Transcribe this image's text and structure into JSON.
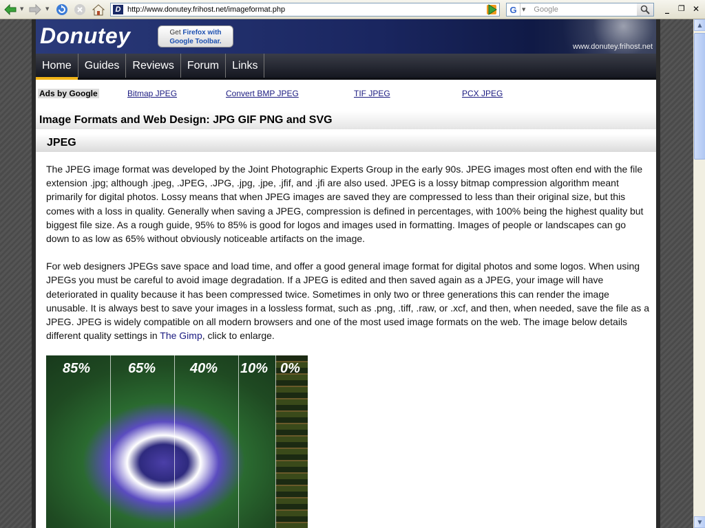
{
  "browser": {
    "url": "http://www.donutey.frihost.net/imageformat.php",
    "search_placeholder": "Google",
    "search_engine_letter": "G"
  },
  "site": {
    "logo": "Donutey",
    "badge_line1_prefix": "Get ",
    "badge_line1_bold": "Firefox with",
    "badge_line2": "Google Toolbar.",
    "url_text": "www.donutey.frihost.net",
    "favicon_letter": "D"
  },
  "nav": [
    "Home",
    "Guides",
    "Reviews",
    "Forum",
    "Links"
  ],
  "ads": {
    "label": "Ads by Google",
    "links": [
      "Bitmap JPEG",
      "Convert BMP JPEG",
      "TIF JPEG",
      "PCX JPEG"
    ]
  },
  "page_title": "Image Formats and Web Design: JPG GIF PNG and SVG",
  "section": {
    "heading": "JPEG",
    "paragraph1": "The JPEG image format was developed by the Joint Photographic Experts Group in the early 90s. JPEG images most often end with the file extension .jpg; although .jpeg, .JPEG, .JPG, .jpg, .jpe, .jfif, and .jfi are also used. JPEG is a lossy bitmap compression algorithm meant primarily for digital photos. Lossy means that when JPEG images are saved they are compressed to less than their original size, but this comes with a loss in quality. Generally when saving a JPEG, compression is defined in percentages, with 100% being the highest quality but biggest file size. As a rough guide, 95% to 85% is good for logos and images used in formatting. Images of people or landscapes can go down to as low as 65% without obviously noticeable artifacts on the image.",
    "paragraph2_before": "For web designers JPEGs save space and load time, and offer a good general image format for digital photos and some logos. When using JPEGs you must be careful to avoid image degradation. If a JPEG is edited and then saved again as a JPEG, your image will have deteriorated in quality because it has been compressed twice. Sometimes in only two or three generations this can render the image unusable. It is always best to save your images in a lossless format, such as .png, .tiff, .raw, or .xcf, and then, when needed, save the file as a JPEG. JPEG is widely compatible on all modern browsers and one of the most used image formats on the web. The image below details different quality settings in ",
    "paragraph2_link": "The Gimp",
    "paragraph2_after": ", click to enlarge."
  },
  "image_labels": [
    "85%",
    "65%",
    "40%",
    "10%",
    "0%"
  ],
  "colors": {
    "header_bg": "#1a2660",
    "nav_bg": "#1e2029",
    "nav_accent": "#f2b418",
    "link": "#1a1a80"
  }
}
